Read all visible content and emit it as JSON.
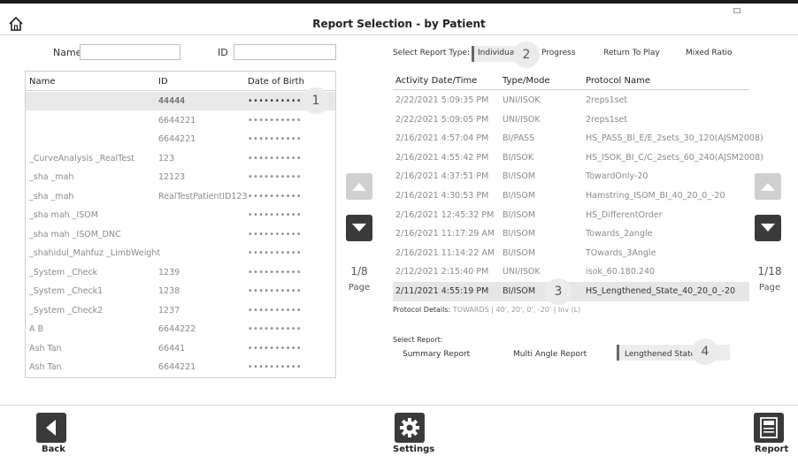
{
  "title": "Report Selection - by Patient",
  "icons": {
    "home": "home-icon",
    "up": "arrow-up-icon",
    "down": "arrow-down-icon",
    "back": "arrow-left-icon",
    "settings": "gear-icon",
    "report": "report-icon"
  },
  "colors": {
    "dark_button": "#3a3a3a",
    "disabled_button": "#cfcfcf",
    "selected_row": "#e8e8e8"
  },
  "search": {
    "name_label": "Name",
    "name_value": "",
    "id_label": "ID",
    "id_value": ""
  },
  "patients": {
    "headers": [
      "Name",
      "ID",
      "Date of Birth"
    ],
    "rows": [
      {
        "name": "",
        "id": "44444",
        "dob": "••••••••••",
        "selected": true
      },
      {
        "name": "",
        "id": "6644221",
        "dob": "••••••••••"
      },
      {
        "name": "",
        "id": "6644221",
        "dob": "••••••••••"
      },
      {
        "name": "_CurveAnalysis _RealTest",
        "id": "123",
        "dob": "••••••••••"
      },
      {
        "name": "_sha _mah",
        "id": "12123",
        "dob": "••••••••••"
      },
      {
        "name": "_sha _mah",
        "id": "RealTestPatientID123",
        "dob": "••••••••••"
      },
      {
        "name": "_sha mah _ISOM",
        "id": "",
        "dob": "••••••••••"
      },
      {
        "name": "_sha mah _ISOM_DNC",
        "id": "",
        "dob": "••••••••••"
      },
      {
        "name": "_shahidul_Mahfuz _LimbWeight",
        "id": "",
        "dob": "••••••••••"
      },
      {
        "name": "_System _Check",
        "id": "1239",
        "dob": "••••••••••"
      },
      {
        "name": "_System _Check1",
        "id": "1238",
        "dob": "••••••••••"
      },
      {
        "name": "_System _Check2",
        "id": "1237",
        "dob": "••••••••••"
      },
      {
        "name": "A B",
        "id": "6644222",
        "dob": "••••••••••"
      },
      {
        "name": "Ash Tan",
        "id": "66441",
        "dob": "••••••••••"
      },
      {
        "name": "Ash Tan",
        "id": "6644221",
        "dob": "••••••••••"
      }
    ],
    "page": "1/8",
    "page_label": "Page"
  },
  "report_type": {
    "label": "Select Report Type:",
    "options": [
      "Individual",
      "Progress",
      "Return To Play",
      "Mixed Ratio"
    ],
    "selected": "Individual"
  },
  "activities": {
    "headers": [
      "Activity Date/Time",
      "Type/Mode",
      "Protocol Name"
    ],
    "rows": [
      {
        "date": "2/22/2021 5:09:35 PM",
        "type": "UNI/ISOK",
        "protocol": "2reps1set"
      },
      {
        "date": "2/22/2021 5:09:05 PM",
        "type": "UNI/ISOK",
        "protocol": "2reps1set"
      },
      {
        "date": "2/16/2021 4:57:04 PM",
        "type": "BI/PASS",
        "protocol": "HS_PASS_BI_E/E_2sets_30_120(AJSM2008)"
      },
      {
        "date": "2/16/2021 4:55:42 PM",
        "type": "BI/ISOK",
        "protocol": "HS_ISOK_BI_C/C_2sets_60_240(AJSM2008)"
      },
      {
        "date": "2/16/2021 4:37:51 PM",
        "type": "BI/ISOM",
        "protocol": "TowardOnly-20"
      },
      {
        "date": "2/16/2021 4:30:53 PM",
        "type": "BI/ISOM",
        "protocol": "Hamstring_ISOM_BI_40_20_0_-20"
      },
      {
        "date": "2/16/2021 12:45:32 PM",
        "type": "BI/ISOM",
        "protocol": "HS_DifferentOrder"
      },
      {
        "date": "2/16/2021 11:17:29 AM",
        "type": "BI/ISOM",
        "protocol": "Towards_2angle"
      },
      {
        "date": "2/16/2021 11:14:22 AM",
        "type": "BI/ISOM",
        "protocol": "TOwards_3Angle"
      },
      {
        "date": "2/12/2021 2:15:40 PM",
        "type": "UNI/ISOK",
        "protocol": "isok_60.180.240"
      },
      {
        "date": "2/11/2021 4:55:19 PM",
        "type": "BI/ISOM",
        "protocol": "HS_Lengthened_State_40_20_0_-20",
        "selected": true
      }
    ],
    "page": "1/18",
    "page_label": "Page"
  },
  "protocol_details": {
    "label": "Protocol Details:",
    "value": "TOWARDS | 40', 20', 0', -20' | Inv (L)"
  },
  "select_report": {
    "label": "Select Report:",
    "options": [
      "Summary Report",
      "Multi Angle Report",
      "Lengthened State"
    ],
    "selected": "Lengthened State"
  },
  "badges": [
    "1",
    "2",
    "3",
    "4"
  ],
  "footer": {
    "back_label": "Back",
    "settings_label": "Settings",
    "report_label": "Report"
  }
}
